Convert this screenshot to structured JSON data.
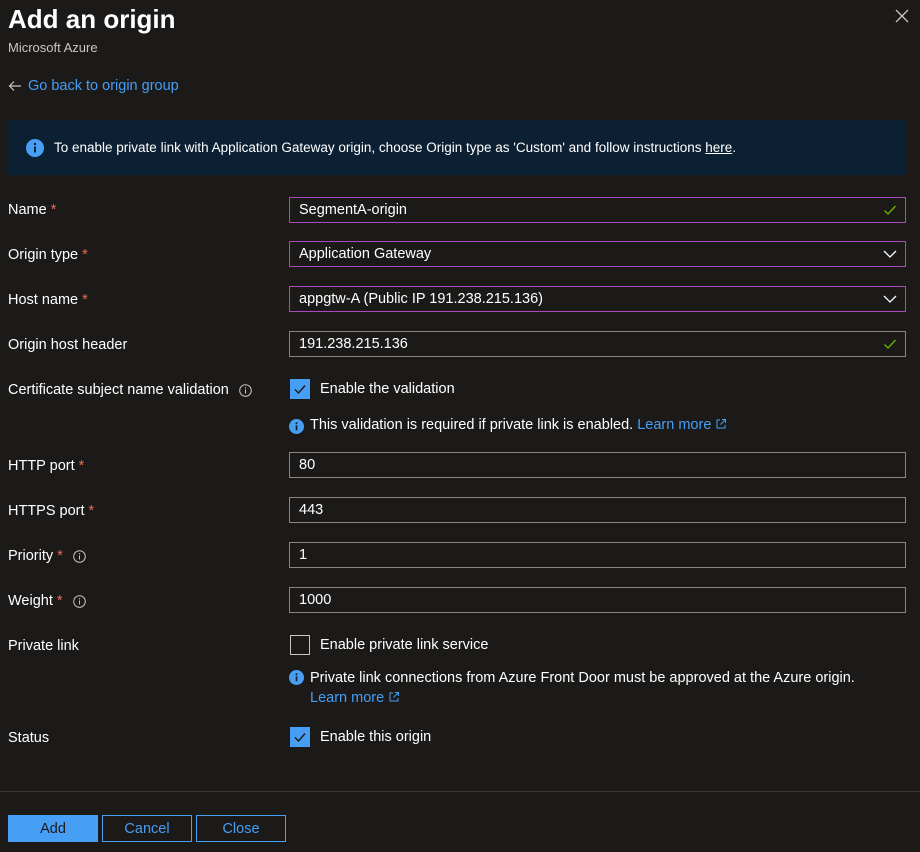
{
  "header": {
    "title": "Add an origin",
    "subtitle": "Microsoft Azure"
  },
  "back_link": "Go back to origin group",
  "banner": {
    "text": "To enable private link with Application Gateway origin, choose Origin type as 'Custom' and follow instructions ",
    "link": "here",
    "suffix": "."
  },
  "form": {
    "name": {
      "label": "Name",
      "value": "SegmentA-origin"
    },
    "origin_type": {
      "label": "Origin type",
      "value": "Application Gateway"
    },
    "host_name": {
      "label": "Host name",
      "value": "appgtw-A (Public IP 191.238.215.136)"
    },
    "origin_host_header": {
      "label": "Origin host header",
      "value": "191.238.215.136"
    },
    "cert_validation": {
      "label": "Certificate subject name validation",
      "checkbox_label": "Enable the validation",
      "checked": true,
      "note": "This validation is required if private link is enabled.",
      "learn_more": "Learn more"
    },
    "http_port": {
      "label": "HTTP port",
      "value": "80"
    },
    "https_port": {
      "label": "HTTPS port",
      "value": "443"
    },
    "priority": {
      "label": "Priority",
      "value": "1"
    },
    "weight": {
      "label": "Weight",
      "value": "1000"
    },
    "private_link": {
      "label": "Private link",
      "checkbox_label": "Enable private link service",
      "checked": false,
      "note": "Private link connections from Azure Front Door must be approved at the Azure origin.",
      "learn_more": "Learn more"
    },
    "status": {
      "label": "Status",
      "checkbox_label": "Enable this origin",
      "checked": true
    },
    "required_marker": "*"
  },
  "footer": {
    "add": "Add",
    "cancel": "Cancel",
    "close": "Close"
  },
  "colors": {
    "accent": "#479ef5",
    "focus_border": "#b146c2",
    "required": "#ef6950",
    "valid_check": "#6bb700",
    "banner_bg": "#0c2033"
  }
}
